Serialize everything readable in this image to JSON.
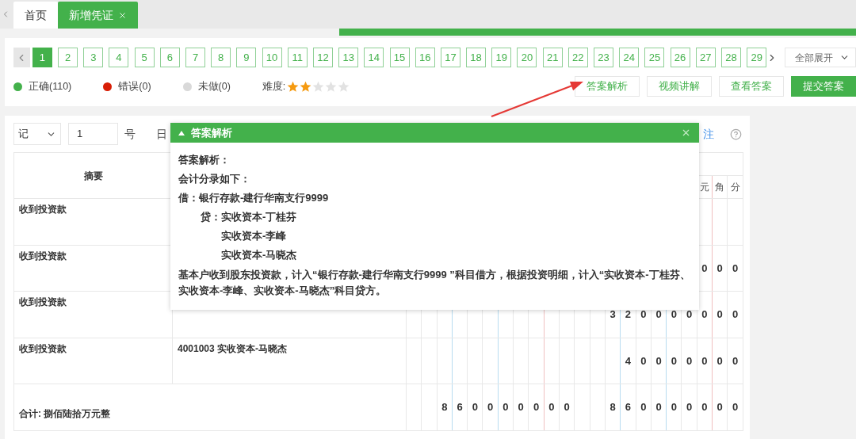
{
  "tabs": [
    {
      "label": "首页",
      "selected": false,
      "closable": false
    },
    {
      "label": "新增凭证",
      "selected": true,
      "closable": true
    }
  ],
  "pagination": {
    "pages": [
      {
        "label": "1",
        "selected": true
      },
      {
        "label": "2",
        "selected": false
      },
      {
        "label": "3",
        "selected": false
      },
      {
        "label": "4",
        "selected": false
      },
      {
        "label": "5",
        "selected": false
      },
      {
        "label": "6",
        "selected": false
      },
      {
        "label": "7",
        "selected": false
      },
      {
        "label": "8",
        "selected": false
      },
      {
        "label": "9",
        "selected": false
      },
      {
        "label": "10",
        "selected": false
      },
      {
        "label": "11",
        "selected": false
      },
      {
        "label": "12",
        "selected": false
      },
      {
        "label": "13",
        "selected": false
      },
      {
        "label": "14",
        "selected": false
      },
      {
        "label": "15",
        "selected": false
      },
      {
        "label": "16",
        "selected": false
      },
      {
        "label": "17",
        "selected": false
      },
      {
        "label": "18",
        "selected": false
      },
      {
        "label": "19",
        "selected": false
      },
      {
        "label": "20",
        "selected": false
      },
      {
        "label": "21",
        "selected": false
      },
      {
        "label": "22",
        "selected": false
      },
      {
        "label": "23",
        "selected": false
      },
      {
        "label": "24",
        "selected": false
      },
      {
        "label": "25",
        "selected": false
      },
      {
        "label": "26",
        "selected": false
      },
      {
        "label": "27",
        "selected": false
      },
      {
        "label": "28",
        "selected": false
      },
      {
        "label": "29",
        "selected": false
      }
    ],
    "expand_dropdown": "全部展开"
  },
  "legend": [
    {
      "label": "正确(110)",
      "color": "#43b14b"
    },
    {
      "label": "错误(0)",
      "color": "#d81e06"
    },
    {
      "label": "未做(0)",
      "color": "#d9d9d9"
    }
  ],
  "difficulty": {
    "label": "难度:",
    "stars": 2
  },
  "actions": [
    {
      "label": "答案解析",
      "primary": false
    },
    {
      "label": "视频讲解",
      "primary": false
    },
    {
      "label": "查看答案",
      "primary": false
    },
    {
      "label": "提交答案",
      "primary": true
    }
  ],
  "voucher": {
    "type": "记",
    "number": "1",
    "number_suffix": "号",
    "date_label": "日",
    "notes_link": "注",
    "columns": {
      "summary": "摘要",
      "credit_units": [
        "元",
        "角",
        "分"
      ]
    },
    "rows": [
      {
        "summary": "收到投资款",
        "account": "",
        "debit": "",
        "credit": ""
      },
      {
        "summary": "收到投资款",
        "account": "",
        "debit": "",
        "credit": "0 0 0"
      },
      {
        "summary": "收到投资款",
        "account": "",
        "debit": "",
        "credit": "3 2 0 0 0 0 0 0 0"
      },
      {
        "summary": "收到投资款",
        "account": "4001003 实收资本-马晓杰",
        "debit": "",
        "credit": "4 0 0 0 0 0 0 0"
      }
    ],
    "total": {
      "label": "合计: 捌佰陆拾万元整",
      "debit": "8 6 0 0 0 0 0 0 0",
      "credit": "8 6 0 0 0 0 0 0 0"
    }
  },
  "analysis_popup": {
    "title": "答案解析",
    "lines": [
      {
        "kind": "heading",
        "text": "答案解析："
      },
      {
        "kind": "heading",
        "text": "会计分录如下："
      },
      {
        "kind": "debit",
        "text": "借：银行存款-建行华南支行9999"
      },
      {
        "kind": "credit",
        "text": "贷：实收资本-丁桂芬"
      },
      {
        "kind": "credit-more",
        "text": "实收资本-李峰"
      },
      {
        "kind": "credit-more",
        "text": "实收资本-马晓杰"
      },
      {
        "kind": "paragraph",
        "text": "基本户收到股东投资款，计入“银行存款-建行华南支行9999 ”科目借方，根据投资明细，计入“实收资本-丁桂芬、实收资本-李峰、实收资本-马晓杰”科目贷方。"
      }
    ]
  }
}
